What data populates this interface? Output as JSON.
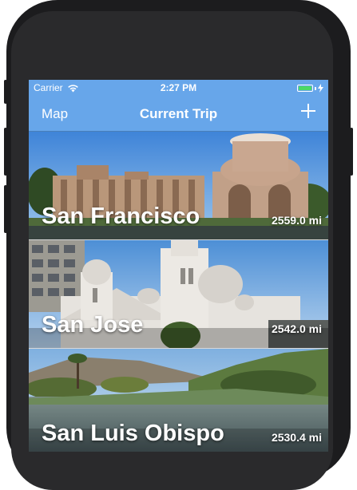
{
  "status_bar": {
    "carrier": "Carrier",
    "time": "2:27 PM"
  },
  "nav": {
    "left_button": "Map",
    "title": "Current Trip",
    "right_icon": "plus-icon"
  },
  "trips": [
    {
      "city": "San Francisco",
      "distance": "2559.0 mi"
    },
    {
      "city": "San Jose",
      "distance": "2542.0 mi"
    },
    {
      "city": "San Luis Obispo",
      "distance": "2530.4 mi"
    }
  ],
  "colors": {
    "nav_bar": "#67a6ea",
    "battery": "#4cd964",
    "frame": "#1c1c1e"
  }
}
